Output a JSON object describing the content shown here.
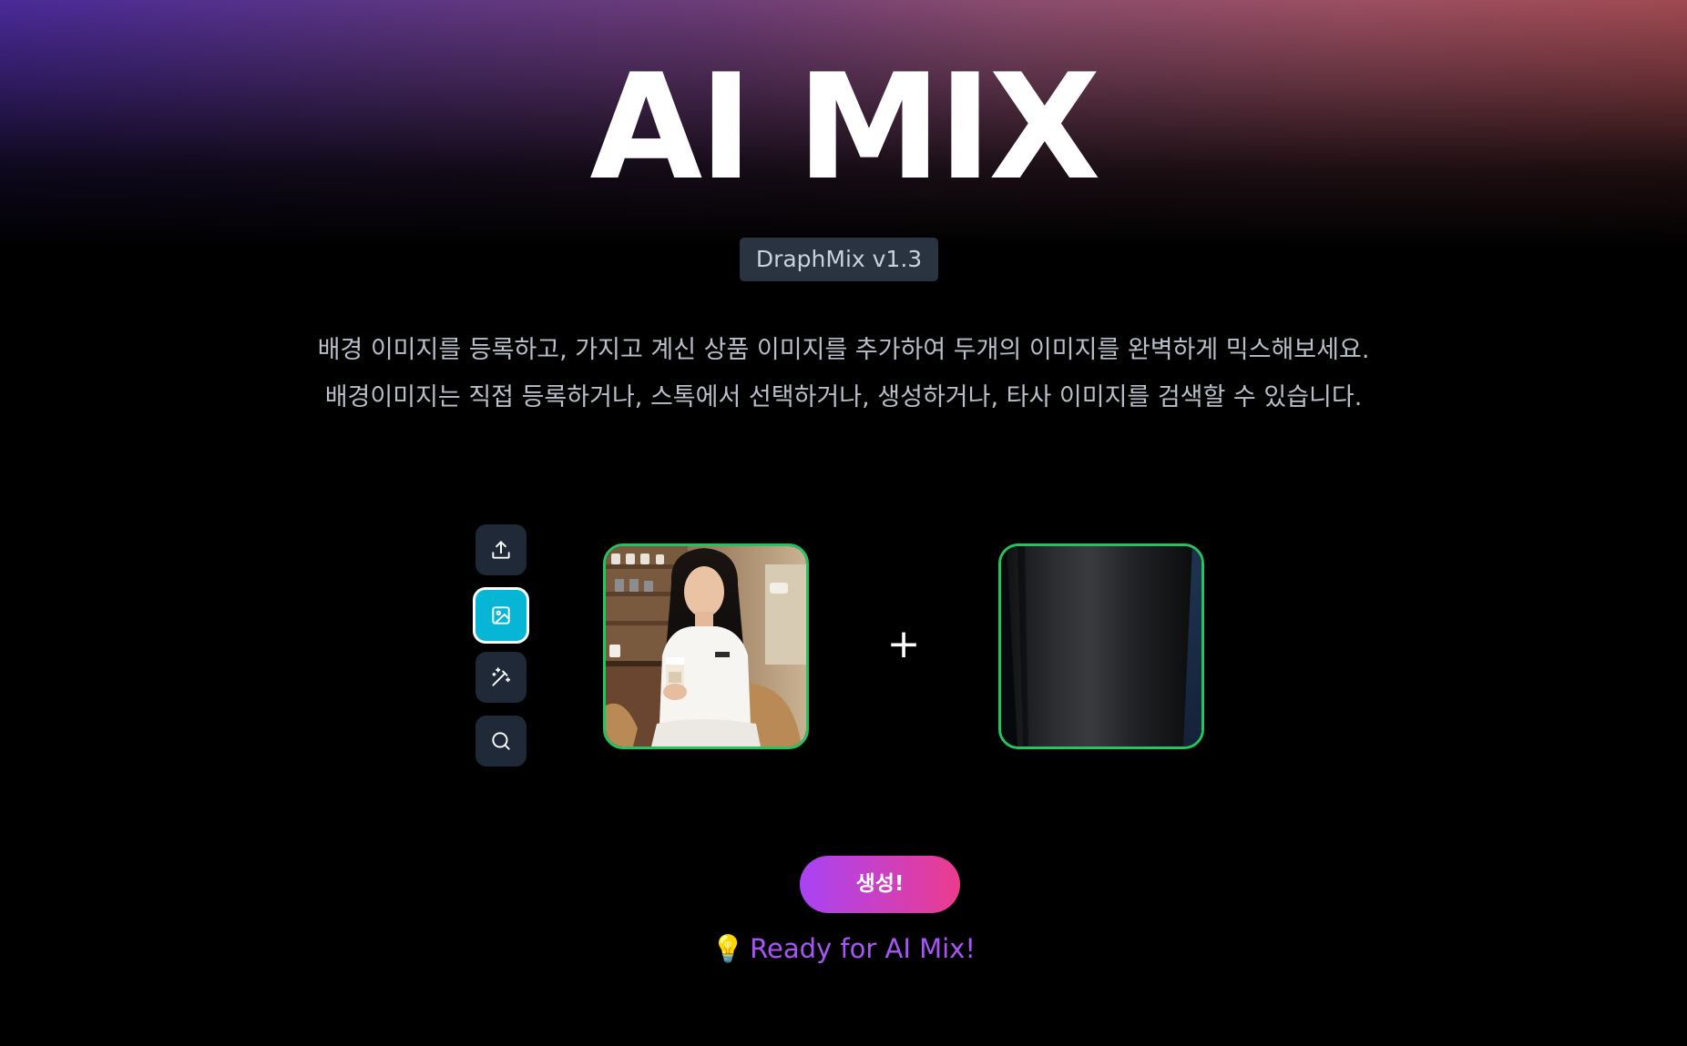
{
  "header": {
    "title": "AI MIX",
    "version": "DraphMix v1.3"
  },
  "description": {
    "line1": "배경 이미지를 등록하고, 가지고 계신 상품 이미지를 추가하여 두개의 이미지를 완벽하게 믹스해보세요.",
    "line2": "배경이미지는 직접 등록하거나, 스톡에서 선택하거나, 생성하거나, 타사 이미지를 검색할 수 있습니다."
  },
  "toolbar": {
    "items": [
      {
        "icon": "upload-icon",
        "active": false
      },
      {
        "icon": "image-icon",
        "active": true
      },
      {
        "icon": "magic-wand-icon",
        "active": false
      },
      {
        "icon": "search-icon",
        "active": false
      }
    ]
  },
  "mix": {
    "plus": "+",
    "background_alt": "Background image preview",
    "product_alt": "Product image preview"
  },
  "action": {
    "generate_label": "생성!",
    "status_icon": "💡",
    "status_text": "Ready for AI Mix!"
  },
  "colors": {
    "accent_cyan": "#06b6d4",
    "frame_green": "#22c55e",
    "status_purple": "#a855f7",
    "button_gradient_start": "#a843f5",
    "button_gradient_end": "#ec3c8c",
    "badge_bg": "#2a3340"
  }
}
